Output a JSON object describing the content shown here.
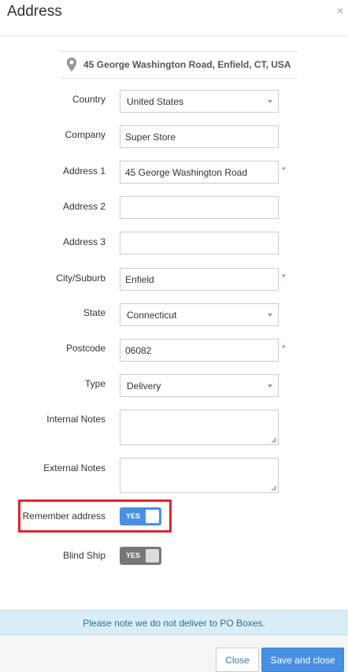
{
  "dialog": {
    "title": "Address",
    "close_glyph": "×"
  },
  "summary": {
    "icon": "map-pin-icon",
    "text": "45 George Washington Road, Enfield, CT, USA"
  },
  "fields": {
    "country": {
      "label": "Country",
      "value": "United States"
    },
    "company": {
      "label": "Company",
      "value": "Super Store"
    },
    "address1": {
      "label": "Address 1",
      "value": "45 George Washington Road",
      "required": "*"
    },
    "address2": {
      "label": "Address 2",
      "value": ""
    },
    "address3": {
      "label": "Address 3",
      "value": ""
    },
    "city": {
      "label": "City/Suburb",
      "value": "Enfield",
      "required": "*"
    },
    "state": {
      "label": "State",
      "value": "Connecticut"
    },
    "postcode": {
      "label": "Postcode",
      "value": "06082",
      "required": "*"
    },
    "type": {
      "label": "Type",
      "value": "Delivery"
    },
    "internal_notes": {
      "label": "Internal Notes",
      "value": ""
    },
    "external_notes": {
      "label": "External Notes",
      "value": ""
    }
  },
  "toggles": {
    "remember": {
      "label": "Remember address",
      "state": "YES",
      "on": true
    },
    "blind_ship": {
      "label": "Blind Ship",
      "state": "YES",
      "on": false
    }
  },
  "notice": "Please note we do not deliver to PO Boxes.",
  "footer": {
    "close_label": "Close",
    "save_label": "Save and close"
  },
  "colors": {
    "accent": "#4a90e2",
    "required": "#d9534f",
    "highlight": "#e0242f",
    "notice_bg": "#d9edf7"
  }
}
